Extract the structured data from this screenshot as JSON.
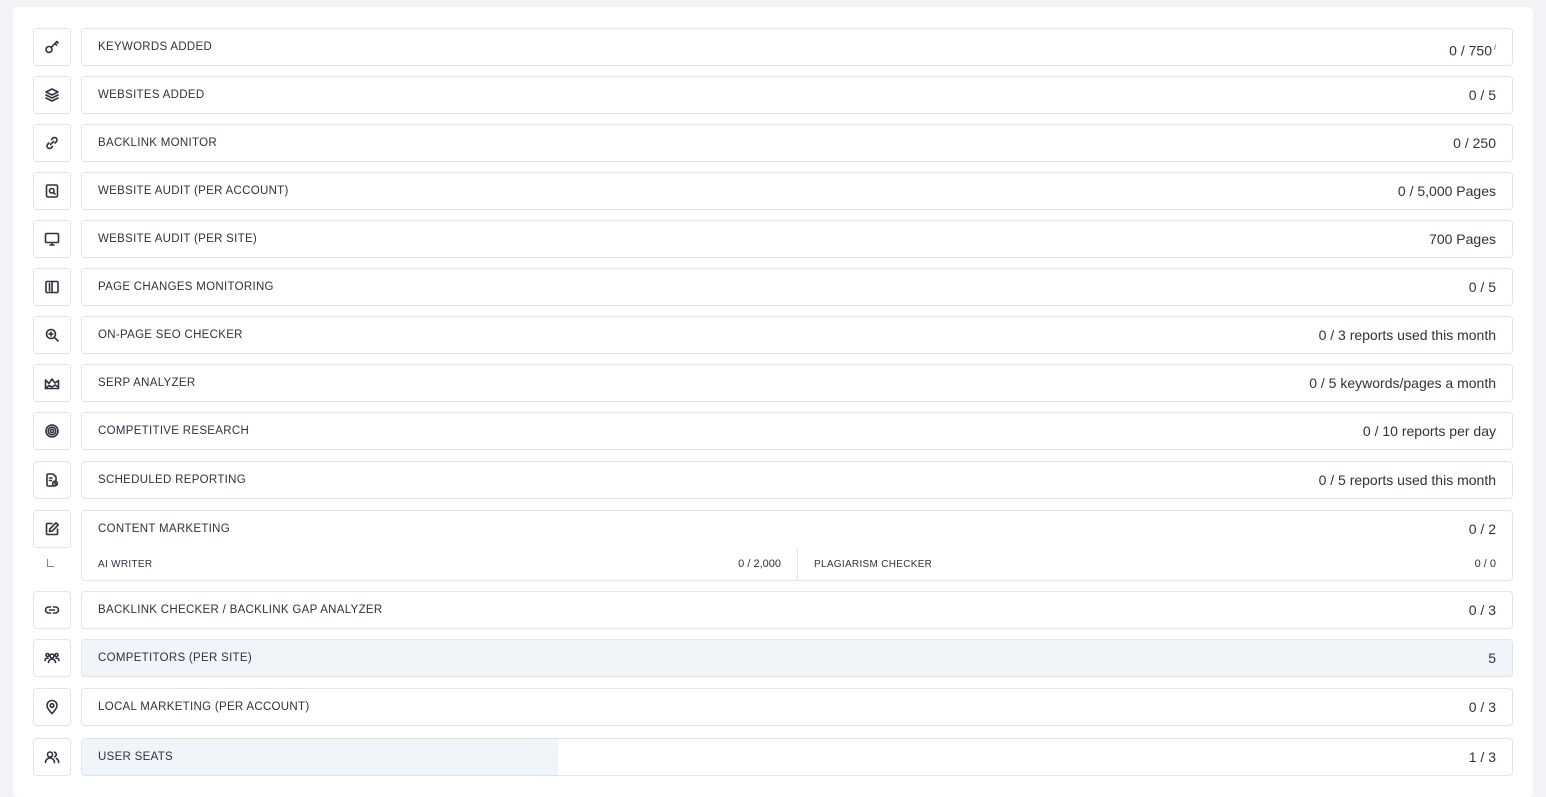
{
  "limits": [
    {
      "label": "KEYWORDS ADDED",
      "value": "0 / 750",
      "info": "i",
      "icon": "key-icon"
    },
    {
      "label": "WEBSITES ADDED",
      "value": "0 / 5",
      "icon": "layers-icon"
    },
    {
      "label": "BACKLINK MONITOR",
      "value": "0 / 250",
      "icon": "link-icon"
    },
    {
      "label": "WEBSITE AUDIT (PER ACCOUNT)",
      "value": "0 / 5,000 Pages",
      "icon": "search-file-icon"
    },
    {
      "label": "WEBSITE AUDIT (PER SITE)",
      "value": "700 Pages",
      "icon": "monitor-icon"
    },
    {
      "label": "PAGE CHANGES MONITORING",
      "value": "0 / 5",
      "icon": "book-open-icon"
    },
    {
      "label": "ON-PAGE SEO CHECKER",
      "value": "0 / 3 reports used this month",
      "icon": "zoom-in-icon"
    },
    {
      "label": "SERP ANALYZER",
      "value": "0 / 5 keywords/pages a month",
      "icon": "area-chart-icon"
    },
    {
      "label": "COMPETITIVE RESEARCH",
      "value": "0 / 10 reports per day",
      "icon": "target-icon"
    },
    {
      "label": "SCHEDULED REPORTING",
      "value": "0 / 5 reports used this month",
      "icon": "report-clock-icon"
    },
    {
      "label": "CONTENT MARKETING",
      "value": "0 / 2",
      "icon": "edit-icon"
    },
    {
      "label": "BACKLINK CHECKER / BACKLINK GAP ANALYZER",
      "value": "0 / 3",
      "icon": "chain-link-icon"
    },
    {
      "label": "COMPETITORS (PER SITE)",
      "value": "5",
      "icon": "users-group-icon",
      "usage_fraction": 1.0
    },
    {
      "label": "LOCAL MARKETING (PER ACCOUNT)",
      "value": "0 / 3",
      "icon": "map-pin-icon"
    },
    {
      "label": "USER SEATS",
      "value": "1 / 3",
      "icon": "users-icon",
      "usage_fraction": 0.333
    }
  ],
  "content_marketing_sub": {
    "ai_writer": {
      "label": "AI WRITER",
      "value": "0 / 2,000"
    },
    "plagiarism_checker": {
      "label": "PLAGIARISM CHECKER",
      "value": "0 / 0"
    }
  },
  "colors": {
    "page_bg": "#f1f3f7",
    "border": "#dfe3ea",
    "usage_fill": "#f0f5fa",
    "text": "#2b3341"
  }
}
